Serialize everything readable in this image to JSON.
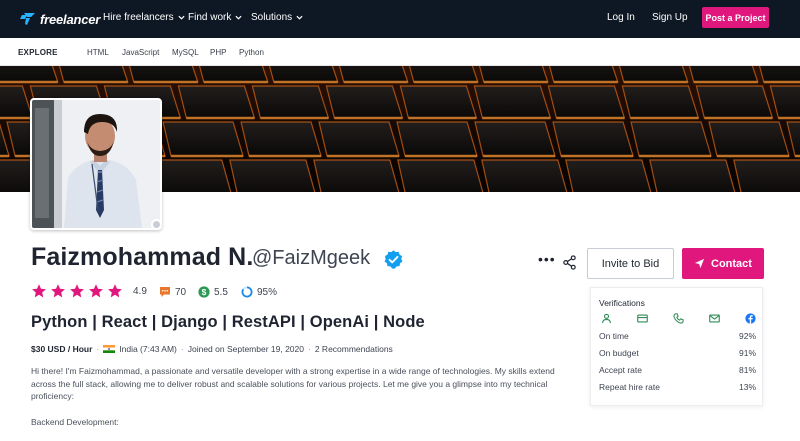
{
  "topnav": {
    "brand": "freelancer",
    "items": [
      {
        "label": "Hire freelancers"
      },
      {
        "label": "Find work"
      },
      {
        "label": "Solutions"
      }
    ],
    "login_label": "Log In",
    "signup_label": "Sign Up",
    "post_project_label": "Post a Project"
  },
  "explore": {
    "label": "EXPLORE",
    "links": [
      "HTML",
      "JavaScript",
      "MySQL",
      "PHP",
      "Python"
    ]
  },
  "profile": {
    "name": "Faizmohammad N.",
    "handle": "@FaizMgeek",
    "verified": true,
    "star_count": 5,
    "rating": "4.9",
    "reviews": "70",
    "earnings_score": "5.5",
    "completion_rate": "95%",
    "tagline": "Python | React | Django | RestAPI | OpenAi | Node",
    "hourly_rate": "$30 USD / Hour",
    "location": "India (7:43 AM)",
    "joined": "Joined on September 19, 2020",
    "recommendations": "2 Recommendations",
    "bio": "Hi there! I'm Faizmohammad, a passionate and versatile developer with a strong expertise in a wide range of technologies. My skills extend across the full stack, allowing me to deliver robust and scalable solutions for various projects. Let me give you a glimpse into my technical proficiency:",
    "bio_section": "Backend Development:"
  },
  "actions": {
    "more_label": "•••",
    "invite_label": "Invite to Bid",
    "contact_label": "Contact"
  },
  "verifications": {
    "title": "Verifications",
    "icons": [
      "user-icon",
      "payment-card-icon",
      "phone-icon",
      "email-icon",
      "facebook-icon"
    ],
    "rows": [
      {
        "label": "On time",
        "value": "92%"
      },
      {
        "label": "On budget",
        "value": "91%"
      },
      {
        "label": "Accept rate",
        "value": "81%"
      },
      {
        "label": "Repeat hire rate",
        "value": "13%"
      }
    ]
  },
  "colors": {
    "nav_bg": "#0e1724",
    "accent": "#e0187d",
    "star": "#e0187d",
    "verified": "#139ff0",
    "verif_green": "#2e8b57",
    "verif_blue": "#1877f2"
  }
}
